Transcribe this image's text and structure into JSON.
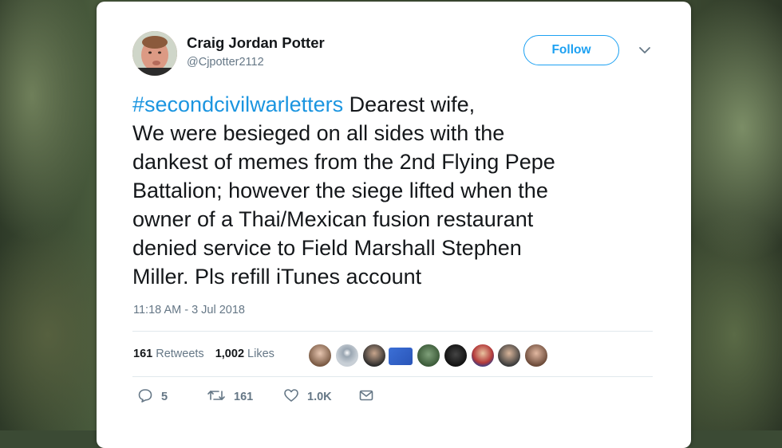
{
  "tweet": {
    "author_name": "Craig Jordan Potter",
    "handle": "@Cjpotter2112",
    "follow_label": "Follow",
    "hashtag": "#secondcivilwarletters",
    "lines": [
      " Dearest wife,",
      "We were besieged on all sides with the",
      "dankest of memes from the 2nd Flying Pepe",
      "Battalion; however the siege lifted when the",
      "owner of a Thai/Mexican fusion restaurant",
      "denied service to Field Marshall Stephen",
      "Miller. Pls refill iTunes account"
    ],
    "timestamp": "11:18 AM - 3 Jul 2018",
    "retweets_count": "161",
    "retweets_label": "Retweets",
    "likes_count": "1,002",
    "likes_label": "Likes",
    "reply_count": "5",
    "retweet_count": "161",
    "like_count": "1.0K",
    "icons": {
      "chevron": "chevron-down-icon",
      "reply": "reply-icon",
      "retweet": "retweet-icon",
      "like": "heart-icon",
      "dm": "envelope-icon"
    },
    "colors": {
      "accent": "#1da1f2",
      "hashtag": "#1b95e0",
      "text": "#14171a",
      "muted": "#657786"
    }
  }
}
